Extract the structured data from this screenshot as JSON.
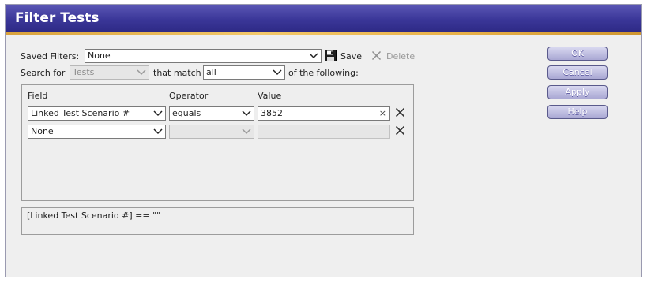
{
  "dialog": {
    "title": "Filter Tests"
  },
  "saved_filters": {
    "label": "Saved Filters:",
    "value": "None",
    "save_label": "Save",
    "delete_label": "Delete"
  },
  "search": {
    "label": "Search for",
    "type_value": "Tests",
    "match_label": "that match",
    "match_value": "all",
    "suffix": "of the following:"
  },
  "columns": {
    "field": "Field",
    "operator": "Operator",
    "value": "Value"
  },
  "rows": [
    {
      "field": "Linked Test Scenario #",
      "operator": "equals",
      "value": "3852"
    },
    {
      "field": "None",
      "operator": "",
      "value": ""
    }
  ],
  "expression": "[Linked Test Scenario #] == \"\"",
  "buttons": {
    "ok": "OK",
    "cancel": "Cancel",
    "apply": "Apply",
    "help": "Help"
  },
  "icons": {
    "save": "floppy-disk-icon",
    "delete": "x-icon",
    "remove_row": "x-icon",
    "dropdown": "chevron-down-icon"
  },
  "colors": {
    "titlebar": "#3b3799",
    "accent_stripe": "#e9b24a",
    "button": "#a9a7d3"
  }
}
